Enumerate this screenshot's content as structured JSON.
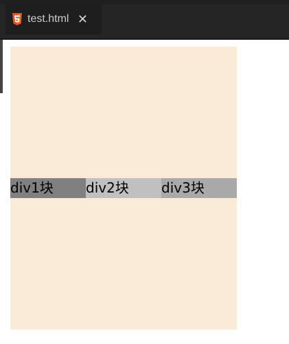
{
  "editor": {
    "tab": {
      "filename": "test.html",
      "close_symbol": "✕",
      "icon": "html5-icon",
      "icon_color": "#e44d26",
      "active": true
    }
  },
  "preview": {
    "container_background": "#faebd7",
    "blocks": [
      {
        "label": "div1块",
        "background": "#808080"
      },
      {
        "label": "div2块",
        "background": "#c0c0c0"
      },
      {
        "label": "div3块",
        "background": "#a9a9a9"
      }
    ]
  }
}
